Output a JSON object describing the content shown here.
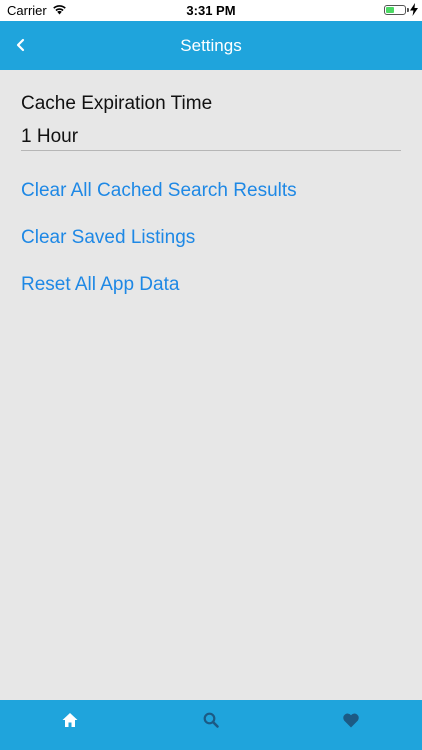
{
  "status_bar": {
    "carrier": "Carrier",
    "time": "3:31 PM",
    "battery_level": 0.45
  },
  "nav": {
    "title": "Settings",
    "back_icon": "chevron-left-icon"
  },
  "settings": {
    "cache_label": "Cache Expiration Time",
    "cache_value": "1 Hour",
    "actions": [
      "Clear All Cached Search Results",
      "Clear Saved Listings",
      "Reset All App Data"
    ]
  },
  "tabs": [
    {
      "icon": "home-icon"
    },
    {
      "icon": "search-icon"
    },
    {
      "icon": "heart-icon"
    }
  ],
  "colors": {
    "primary": "#1fa4dc",
    "link": "#1e88e5",
    "background": "#e7e7e7",
    "active_tab": "#ffffff",
    "inactive_tab": "#1c5a84"
  }
}
